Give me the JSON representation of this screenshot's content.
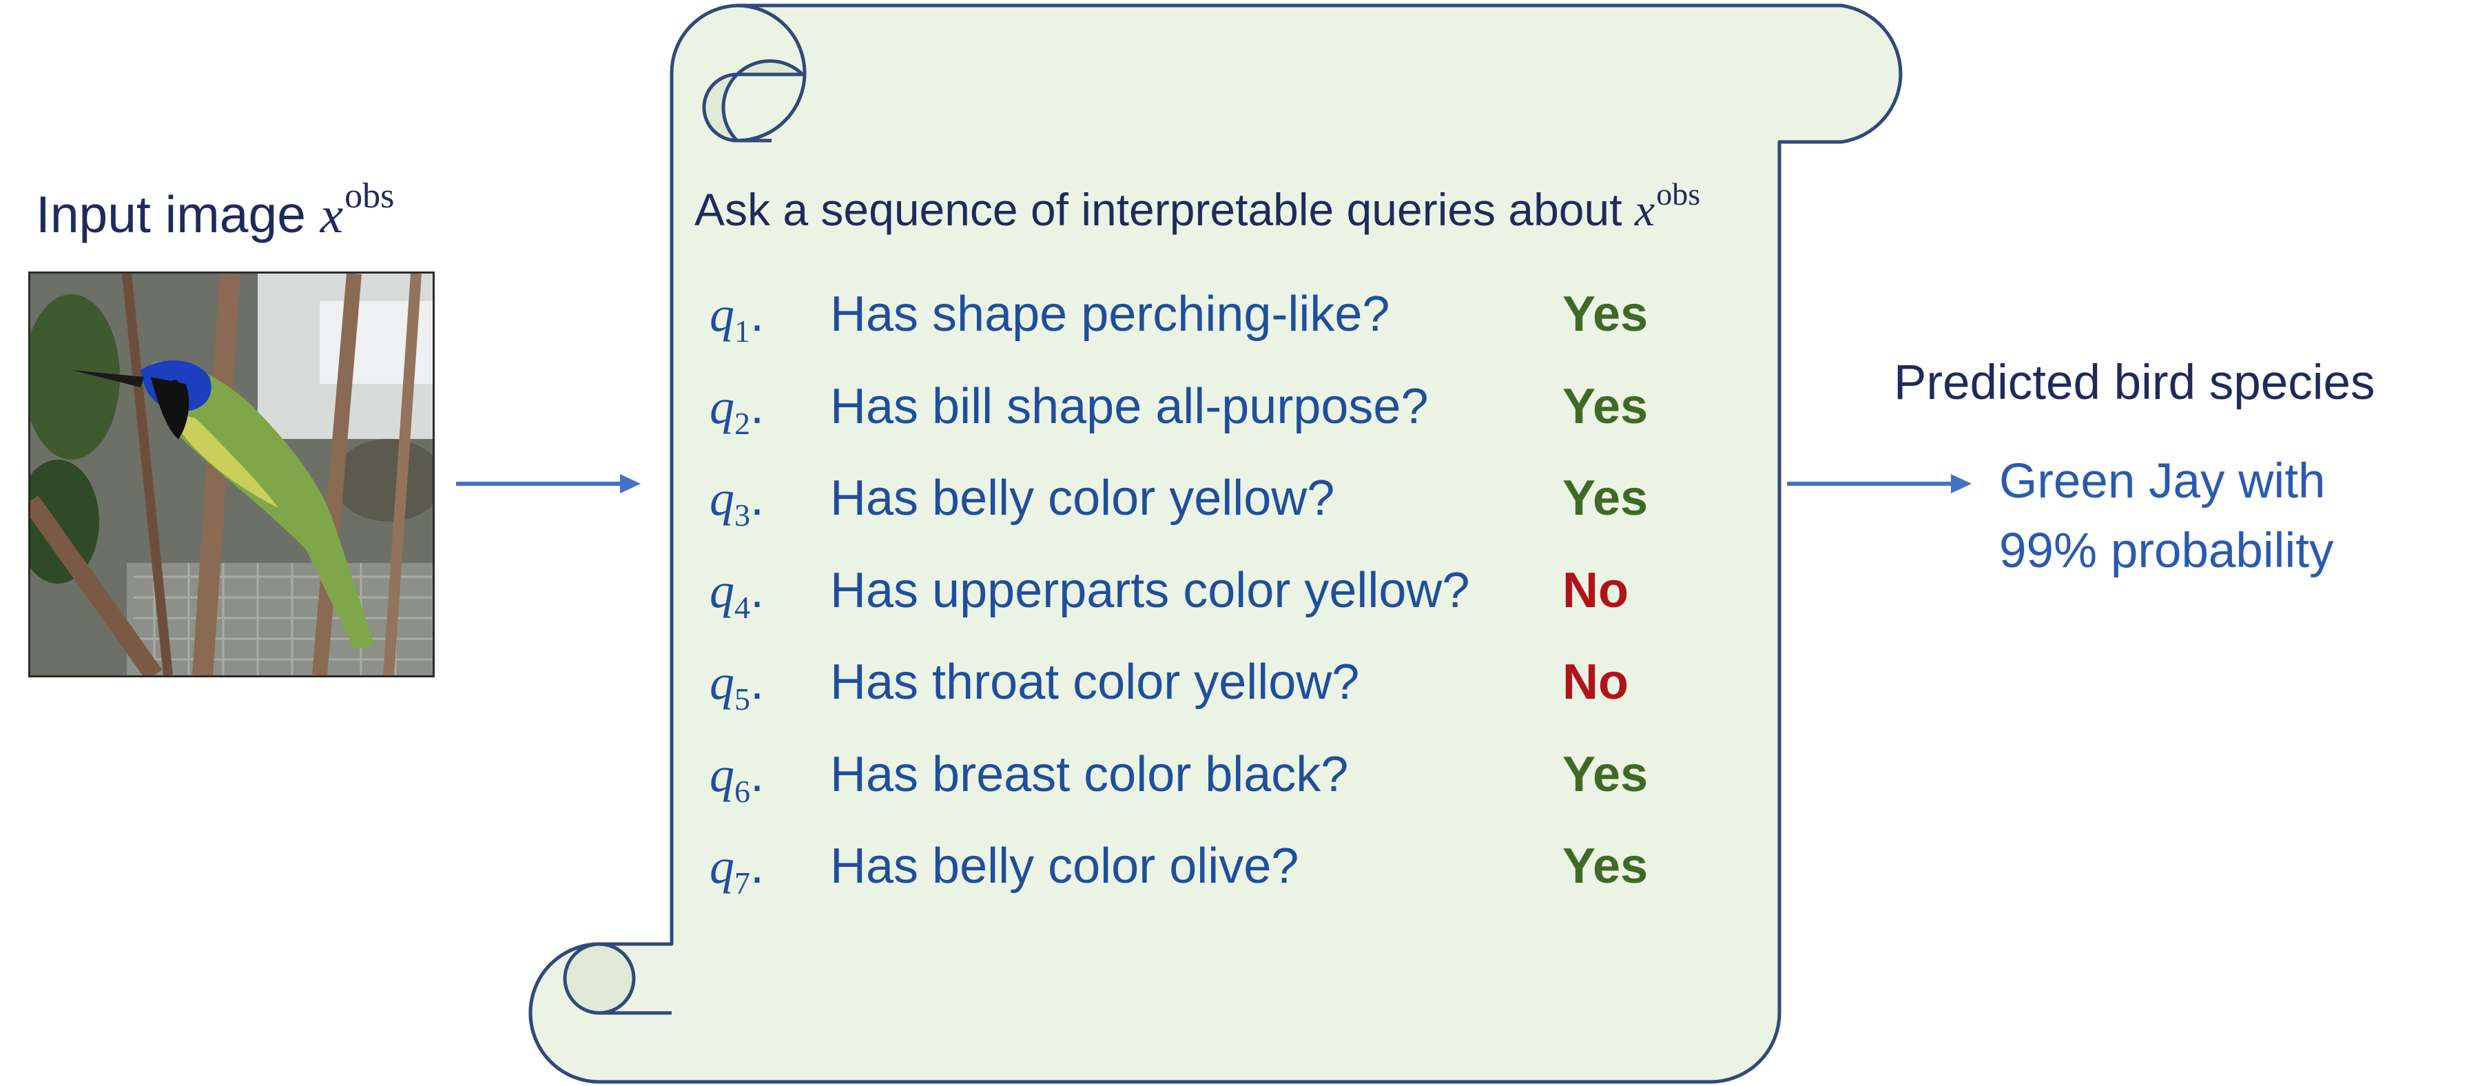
{
  "input": {
    "label_text": "Input image ",
    "variable": "x",
    "superscript": "obs"
  },
  "panel": {
    "header_text": "Ask a sequence of interpretable queries about ",
    "header_variable": "x",
    "header_superscript": "obs",
    "queries": [
      {
        "symbol": "q",
        "index": "1",
        "text": "Has shape perching-like?",
        "answer": "Yes"
      },
      {
        "symbol": "q",
        "index": "2",
        "text": "Has bill shape all-purpose?",
        "answer": "Yes"
      },
      {
        "symbol": "q",
        "index": "3",
        "text": "Has belly color yellow?",
        "answer": "Yes"
      },
      {
        "symbol": "q",
        "index": "4",
        "text": "Has upperparts color yellow?",
        "answer": "No"
      },
      {
        "symbol": "q",
        "index": "5",
        "text": "Has throat color yellow?",
        "answer": "No"
      },
      {
        "symbol": "q",
        "index": "6",
        "text": "Has breast color black?",
        "answer": "Yes"
      },
      {
        "symbol": "q",
        "index": "7",
        "text": "Has belly color olive?",
        "answer": "Yes"
      }
    ]
  },
  "prediction": {
    "label": "Predicted bird species",
    "result_line1": "Green Jay with",
    "result_line2": "99% probability"
  },
  "colors": {
    "scroll_fill": "#ebf3e4",
    "scroll_stroke": "#2f4a7a",
    "arrow": "#4472c4",
    "yes": "#3f6a26",
    "no": "#b0141a",
    "query_text": "#1f4e9c"
  }
}
